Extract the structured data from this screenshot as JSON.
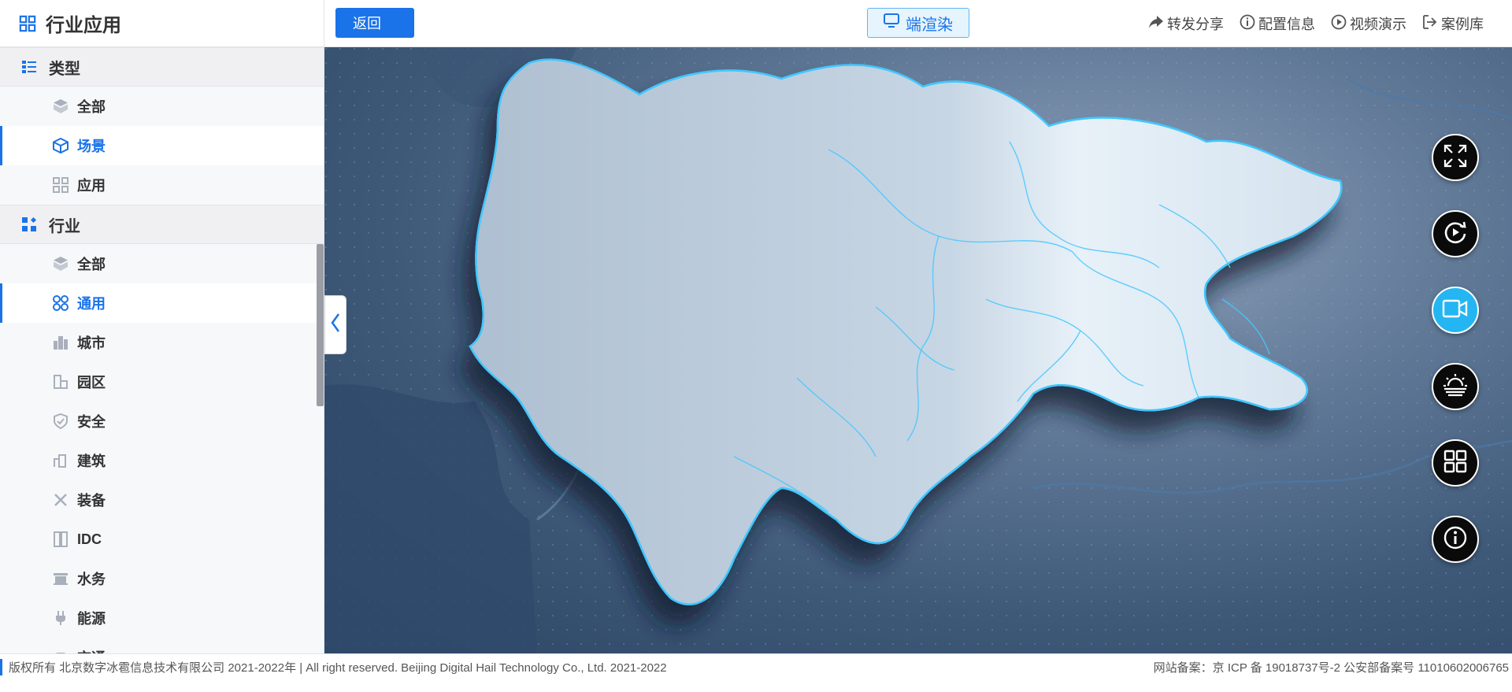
{
  "sidebar": {
    "title": "行业应用",
    "groups": [
      {
        "label": "类型",
        "items": [
          {
            "label": "全部",
            "icon": "cube-layers-icon"
          },
          {
            "label": "场景",
            "icon": "cube-icon",
            "active": true
          },
          {
            "label": "应用",
            "icon": "grid-apps-icon"
          }
        ]
      },
      {
        "label": "行业",
        "items": [
          {
            "label": "全部",
            "icon": "cube-layers-icon"
          },
          {
            "label": "通用",
            "icon": "four-circles-icon",
            "active": true
          },
          {
            "label": "城市",
            "icon": "city-buildings-icon"
          },
          {
            "label": "园区",
            "icon": "park-buildings-icon"
          },
          {
            "label": "安全",
            "icon": "shield-check-icon"
          },
          {
            "label": "建筑",
            "icon": "building-icon"
          },
          {
            "label": "装备",
            "icon": "tools-icon"
          },
          {
            "label": "IDC",
            "icon": "server-rack-icon"
          },
          {
            "label": "水务",
            "icon": "water-icon"
          },
          {
            "label": "能源",
            "icon": "plug-icon"
          },
          {
            "label": "交通",
            "icon": "traffic-icon"
          }
        ]
      }
    ]
  },
  "topbar": {
    "back_label": "返回",
    "render_label": "端渲染",
    "actions": [
      {
        "label": "转发分享",
        "icon": "share-arrow-icon"
      },
      {
        "label": "配置信息",
        "icon": "info-circle-icon"
      },
      {
        "label": "视频演示",
        "icon": "play-circle-icon"
      },
      {
        "label": "案例库",
        "icon": "exit-library-icon"
      }
    ]
  },
  "float_buttons": [
    {
      "name": "fullscreen-button",
      "icon": "expand-arrows-icon"
    },
    {
      "name": "rotate-button",
      "icon": "rotate-icon"
    },
    {
      "name": "video-camera-button",
      "icon": "video-camera-icon",
      "active": true
    },
    {
      "name": "weather-button",
      "icon": "sun-haze-icon"
    },
    {
      "name": "layout-grid-button",
      "icon": "grid-icon"
    },
    {
      "name": "info-button",
      "icon": "info-icon"
    }
  ],
  "footer": {
    "copyright": "版权所有 北京数字冰雹信息技术有限公司 2021-2022年 | All right reserved. Beijing Digital Hail Technology Co., Ltd. 2021-2022",
    "icp": "网站备案：京 ICP 备 19018737号-2 公安部备案号 11010602006765"
  },
  "colors": {
    "accent": "#1a73e8",
    "active_float": "#23b6f2",
    "map_land": "#d6e2ee",
    "map_border": "#3fc7ff"
  }
}
